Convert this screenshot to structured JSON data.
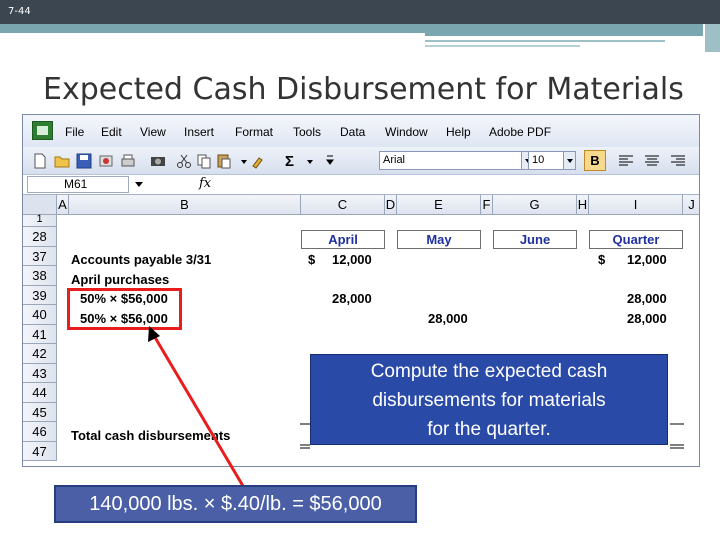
{
  "slide": {
    "number": "7-44",
    "title": "Expected Cash Disbursement for Materials"
  },
  "excel": {
    "menu": [
      "File",
      "Edit",
      "View",
      "Insert",
      "Format",
      "Tools",
      "Data",
      "Window",
      "Help",
      "Adobe PDF"
    ],
    "toolbar": {
      "font": "Arial",
      "size": "10",
      "bold": "B",
      "sigma": "Σ"
    },
    "name_box": "M61",
    "fx": "fx",
    "columns": [
      "A",
      "B",
      "C",
      "D",
      "E",
      "F",
      "G",
      "H",
      "I",
      "J"
    ],
    "rows": [
      "1",
      "28",
      "37",
      "38",
      "39",
      "40",
      "41",
      "42",
      "43",
      "44",
      "45",
      "46",
      "47"
    ],
    "headers": {
      "april": "April",
      "may": "May",
      "june": "June",
      "quarter": "Quarter"
    },
    "labels": {
      "accounts_payable": "Accounts payable 3/31",
      "april_purchases": "April purchases",
      "pct1": "50% × $56,000",
      "pct2": "50% × $56,000",
      "total": "Total cash disbursements"
    },
    "values": {
      "r37_c_sign": "$",
      "r37_c": "12,000",
      "r37_i_sign": "$",
      "r37_i": "12,000",
      "r39_c": "28,000",
      "r39_i": "28,000",
      "r40_e": "28,000",
      "r40_i": "28,000"
    }
  },
  "callout": {
    "line1": "Compute the expected cash",
    "line2": "disbursements for materials",
    "line3": "for the quarter."
  },
  "note": "140,000 lbs. × $.40/lb. = $56,000",
  "colors": {
    "callout_bg": "#2a4aa8",
    "red_highlight": "#e81d1d",
    "header_text": "#2030a0",
    "slide_band": "#3b4650",
    "teal": "#7aa6b0"
  }
}
